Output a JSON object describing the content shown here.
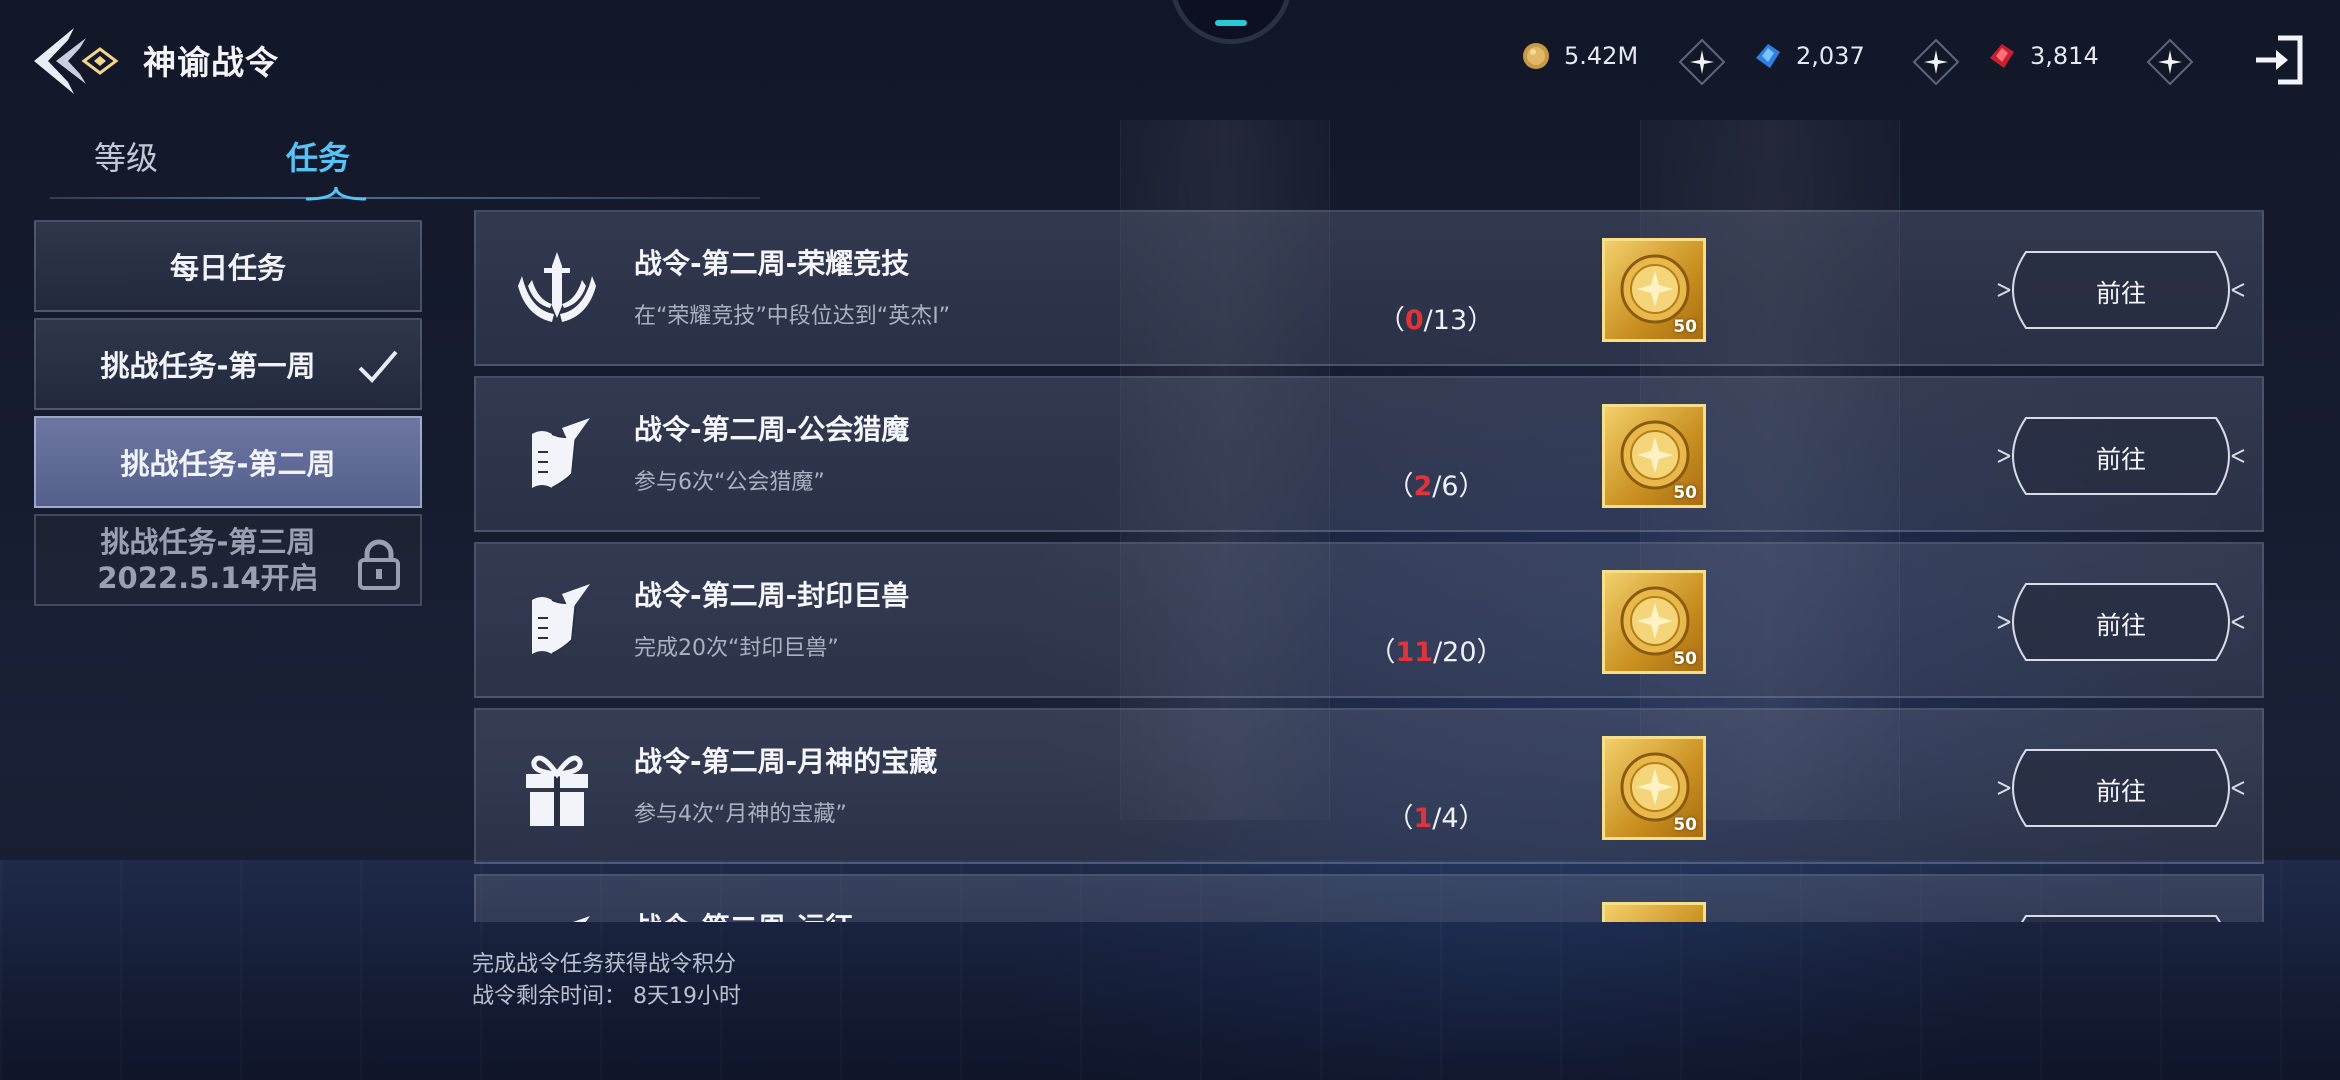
{
  "header": {
    "title": "神谕战令",
    "currencies": [
      {
        "icon": "gold-coin-icon",
        "value": "5.42M"
      },
      {
        "icon": "blue-diamond-icon",
        "value": "2,037"
      },
      {
        "icon": "red-gem-icon",
        "value": "3,814"
      }
    ]
  },
  "tabs": [
    {
      "label": "等级",
      "active": false
    },
    {
      "label": "任务",
      "active": true
    }
  ],
  "sidebar": {
    "items": [
      {
        "label": "每日任务",
        "state": "normal"
      },
      {
        "label": "挑战任务-第一周",
        "state": "completed"
      },
      {
        "label": "挑战任务-第二周",
        "state": "active"
      },
      {
        "label": "挑战任务-第三周",
        "sublabel": "2022.5.14开启",
        "state": "locked"
      }
    ]
  },
  "tasks": [
    {
      "icon": "crossed-swords-emblem-icon",
      "title": "战令-第二周-荣耀竞技",
      "desc": "在“荣耀竞技”中段位达到“英杰Ⅰ”",
      "progress_open": "（",
      "progress_current": "0",
      "progress_rest": "/13）",
      "reward_qty": "50",
      "button": "前往"
    },
    {
      "icon": "scroll-quill-icon",
      "title": "战令-第二周-公会猎魔",
      "desc": "参与6次“公会猎魔”",
      "progress_open": "（",
      "progress_current": "2",
      "progress_rest": "/6）",
      "reward_qty": "50",
      "button": "前往"
    },
    {
      "icon": "scroll-quill-icon",
      "title": "战令-第二周-封印巨兽",
      "desc": "完成20次“封印巨兽”",
      "progress_open": "（",
      "progress_current": "11",
      "progress_rest": "/20）",
      "reward_qty": "50",
      "button": "前往"
    },
    {
      "icon": "gift-box-icon",
      "title": "战令-第二周-月神的宝藏",
      "desc": "参与4次“月神的宝藏”",
      "progress_open": "（",
      "progress_current": "1",
      "progress_rest": "/4）",
      "reward_qty": "50",
      "button": "前往"
    },
    {
      "icon": "scroll-quill-icon",
      "title": "战令-第二周-远征",
      "desc": "",
      "progress_open": "",
      "progress_current": "",
      "progress_rest": "",
      "reward_qty": "",
      "button": ""
    }
  ],
  "footer": {
    "line1": "完成战令任务获得战令积分",
    "line2": "战令剩余时间：  8天19小时"
  },
  "colors": {
    "accent_tab": "#57c2f5",
    "progress_current": "#e0343a",
    "reward_gold": "#f3cf6a",
    "active_sidebar": "#6d77a2"
  }
}
